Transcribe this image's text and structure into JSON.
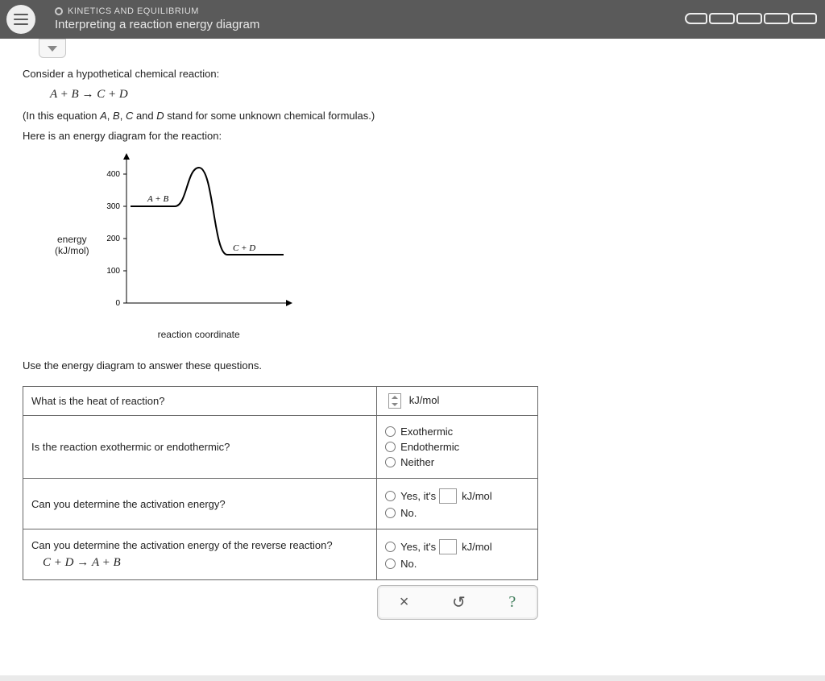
{
  "header": {
    "topic": "KINETICS AND EQUILIBRIUM",
    "title": "Interpreting a reaction energy diagram"
  },
  "intro": {
    "line1": "Consider a hypothetical chemical reaction:",
    "equation_lhs": "A + B",
    "equation_rhs": "C + D",
    "line2_prefix": "(In this equation ",
    "vars": [
      "A",
      "B",
      "C",
      "D"
    ],
    "line2_suffix": " stand for some unknown chemical formulas.)",
    "line3": "Here is an energy diagram for the reaction:"
  },
  "chart_data": {
    "type": "line",
    "ylabel": "energy\n(kJ/mol)",
    "xlabel": "reaction coordinate",
    "ylim": [
      0,
      420
    ],
    "yticks": [
      0,
      100,
      200,
      300,
      400
    ],
    "series": [
      {
        "name": "A + B",
        "energy": 300
      },
      {
        "name": "transition",
        "energy": 420
      },
      {
        "name": "C + D",
        "energy": 150
      }
    ]
  },
  "use_line": "Use the energy diagram to answer these questions.",
  "questions": {
    "q1": {
      "prompt": "What is the heat of reaction?",
      "unit": "kJ/mol"
    },
    "q2": {
      "prompt": "Is the reaction exothermic or endothermic?",
      "opts": [
        "Exothermic",
        "Endothermic",
        "Neither"
      ]
    },
    "q3": {
      "prompt": "Can you determine the activation energy?",
      "yes_prefix": "Yes, it's",
      "unit": "kJ/mol",
      "no_label": "No."
    },
    "q4": {
      "prompt": "Can you determine the activation energy of the reverse reaction?",
      "rev_lhs": "C + D",
      "rev_rhs": "A + B",
      "yes_prefix": "Yes, it's",
      "unit": "kJ/mol",
      "no_label": "No."
    }
  },
  "footer": {
    "cancel": "×",
    "reset": "↺",
    "help": "?"
  }
}
